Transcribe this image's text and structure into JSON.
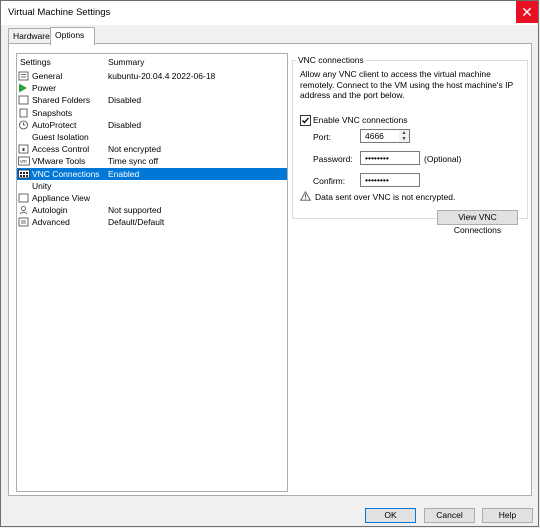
{
  "window": {
    "title": "Virtual Machine Settings",
    "close_glyph": "✕"
  },
  "tabs": [
    {
      "label": "Hardware"
    },
    {
      "label": "Options"
    }
  ],
  "tree": {
    "col_settings": "Settings",
    "col_summary": "Summary",
    "rows": [
      {
        "name": "General",
        "summary": "kubuntu-20.04.4 2022-06-18",
        "icon": "general-icon"
      },
      {
        "name": "Power",
        "summary": "",
        "icon": "power-icon"
      },
      {
        "name": "Shared Folders",
        "summary": "Disabled",
        "icon": "folder-icon"
      },
      {
        "name": "Snapshots",
        "summary": "",
        "icon": "snapshot-icon"
      },
      {
        "name": "AutoProtect",
        "summary": "Disabled",
        "icon": "autoprotect-icon"
      },
      {
        "name": "Guest Isolation",
        "summary": "",
        "icon": "guest-isolation-icon"
      },
      {
        "name": "Access Control",
        "summary": "Not encrypted",
        "icon": "access-control-icon"
      },
      {
        "name": "VMware Tools",
        "summary": "Time sync off",
        "icon": "vmware-tools-icon"
      },
      {
        "name": "VNC Connections",
        "summary": "Enabled",
        "icon": "vnc-icon"
      },
      {
        "name": "Unity",
        "summary": "",
        "icon": "unity-icon"
      },
      {
        "name": "Appliance View",
        "summary": "",
        "icon": "appliance-icon"
      },
      {
        "name": "Autologin",
        "summary": "Not supported",
        "icon": "autologin-icon"
      },
      {
        "name": "Advanced",
        "summary": "Default/Default",
        "icon": "advanced-icon"
      }
    ]
  },
  "vnc": {
    "group_title": "VNC connections",
    "description": "Allow any VNC client to access the virtual machine remotely. Connect to the VM using the host machine's IP address and the port below.",
    "enable_label": "Enable VNC connections",
    "enabled": true,
    "port_label": "Port:",
    "port_value": "4666",
    "password_label": "Password:",
    "password_value": "••••••••",
    "password_hint": "(Optional)",
    "confirm_label": "Confirm:",
    "confirm_value": "••••••••",
    "warning_text": "Data sent over VNC is not encrypted.",
    "view_button": "View VNC Connections"
  },
  "footer": {
    "ok": "OK",
    "cancel": "Cancel",
    "help": "Help"
  },
  "colors": {
    "selection": "#0078d7",
    "close": "#e81123",
    "power": "#2ea043"
  }
}
